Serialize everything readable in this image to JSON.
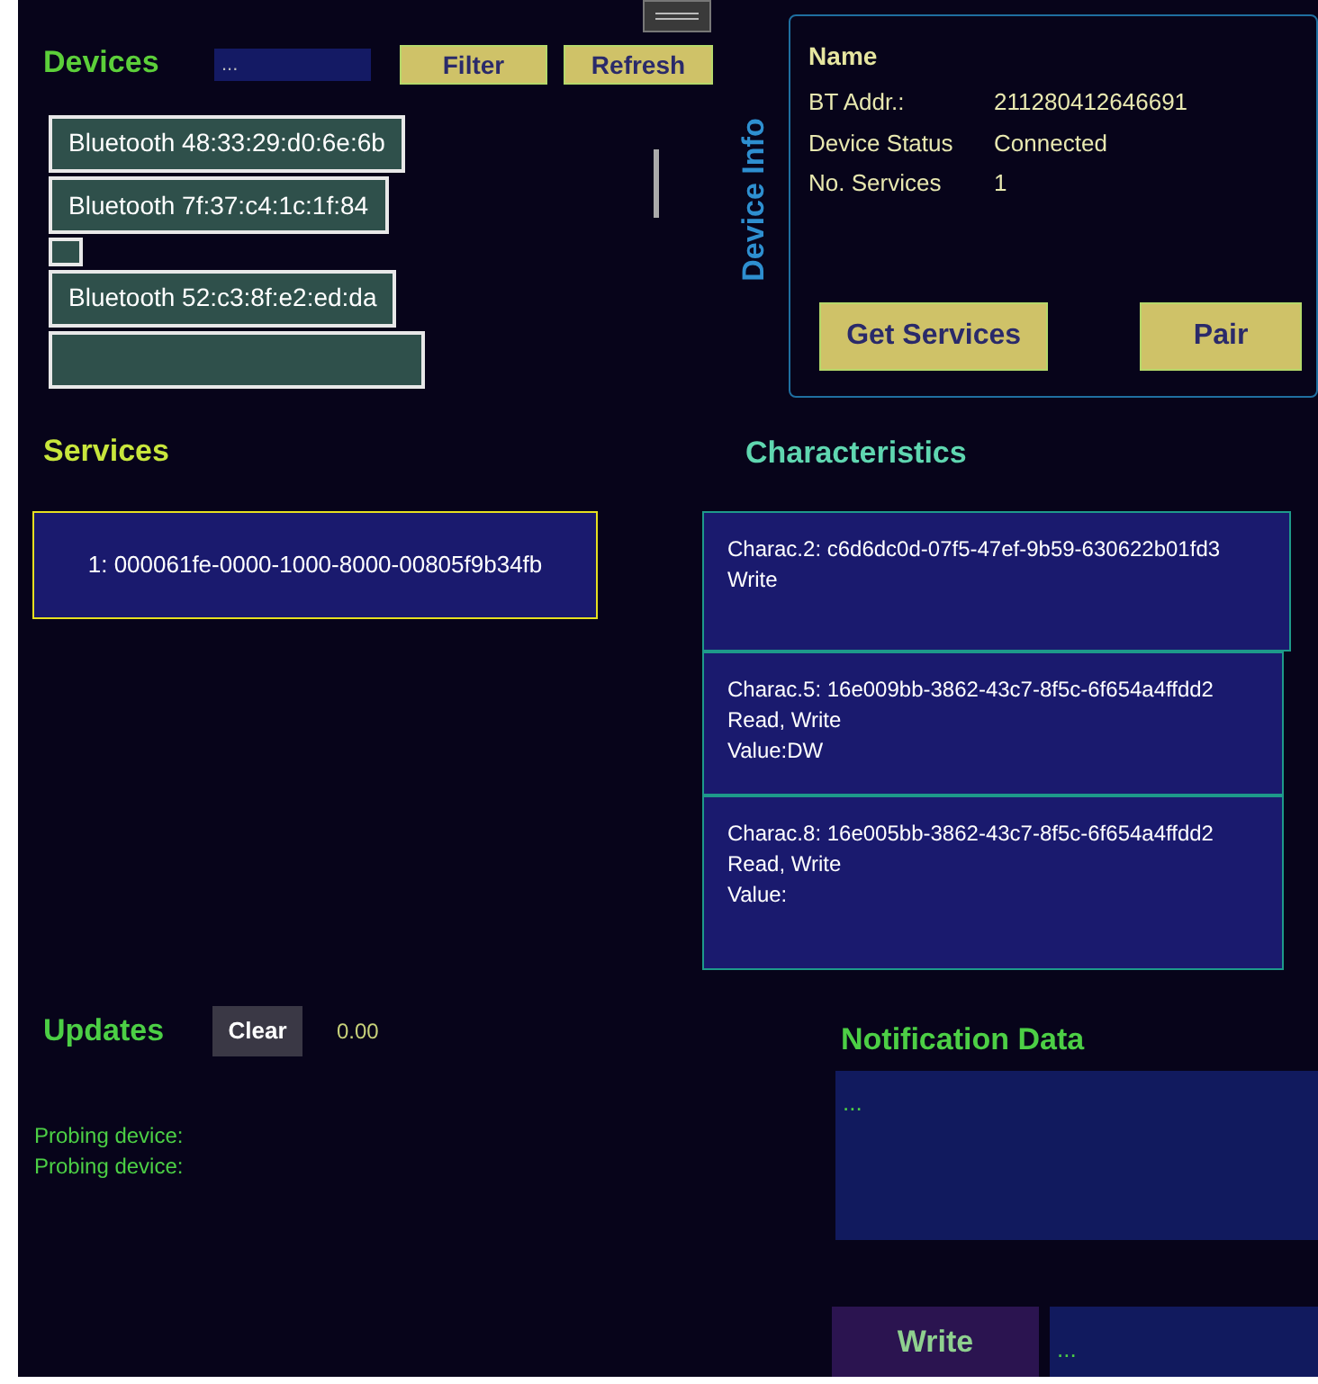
{
  "devices": {
    "title": "Devices",
    "filter_placeholder": "...",
    "buttons": [
      "Filter",
      "Refresh"
    ],
    "items": [
      {
        "kind": "device",
        "label": "Bluetooth 48:33:29:d0:6e:6b"
      },
      {
        "kind": "device",
        "label": "Bluetooth 7f:37:c4:1c:1f:84"
      },
      {
        "kind": "blank"
      },
      {
        "kind": "device",
        "label": "Bluetooth 52:c3:8f:e2:ed:da"
      },
      {
        "kind": "blank"
      }
    ]
  },
  "device_info": {
    "title": "Device Info",
    "name": "Name",
    "fields": [
      {
        "label": "BT Addr.:",
        "value": "211280412646691"
      },
      {
        "label": "Device Status",
        "value": "Connected"
      },
      {
        "label": "No. Services",
        "value": "1"
      }
    ],
    "buttons": [
      "Get Services",
      "Pair"
    ]
  },
  "services": {
    "title": "Services",
    "items": [
      {
        "label": "1: 000061fe-0000-1000-8000-00805f9b34fb",
        "selected": true
      }
    ]
  },
  "characteristics": {
    "title": "Characteristics",
    "items": [
      {
        "lines": [
          "Charac.2: c6d6dc0d-07f5-47ef-9b59-630622b01fd3",
          "Write"
        ]
      },
      {
        "lines": [
          "Charac.5: 16e009bb-3862-43c7-8f5c-6f654a4ffdd2",
          "Read, Write",
          "Value:DW"
        ]
      },
      {
        "lines": [
          "Charac.8: 16e005bb-3862-43c7-8f5c-6f654a4ffdd2",
          "Read, Write",
          "Value:"
        ]
      }
    ]
  },
  "updates": {
    "title": "Updates",
    "clear_button": "Clear",
    "counter": "0.00",
    "log": [
      "Probing device:",
      "Probing device:"
    ]
  },
  "notification": {
    "title": "Notification Data",
    "placeholder": "...",
    "write_button": "Write",
    "write_placeholder": "..."
  }
}
